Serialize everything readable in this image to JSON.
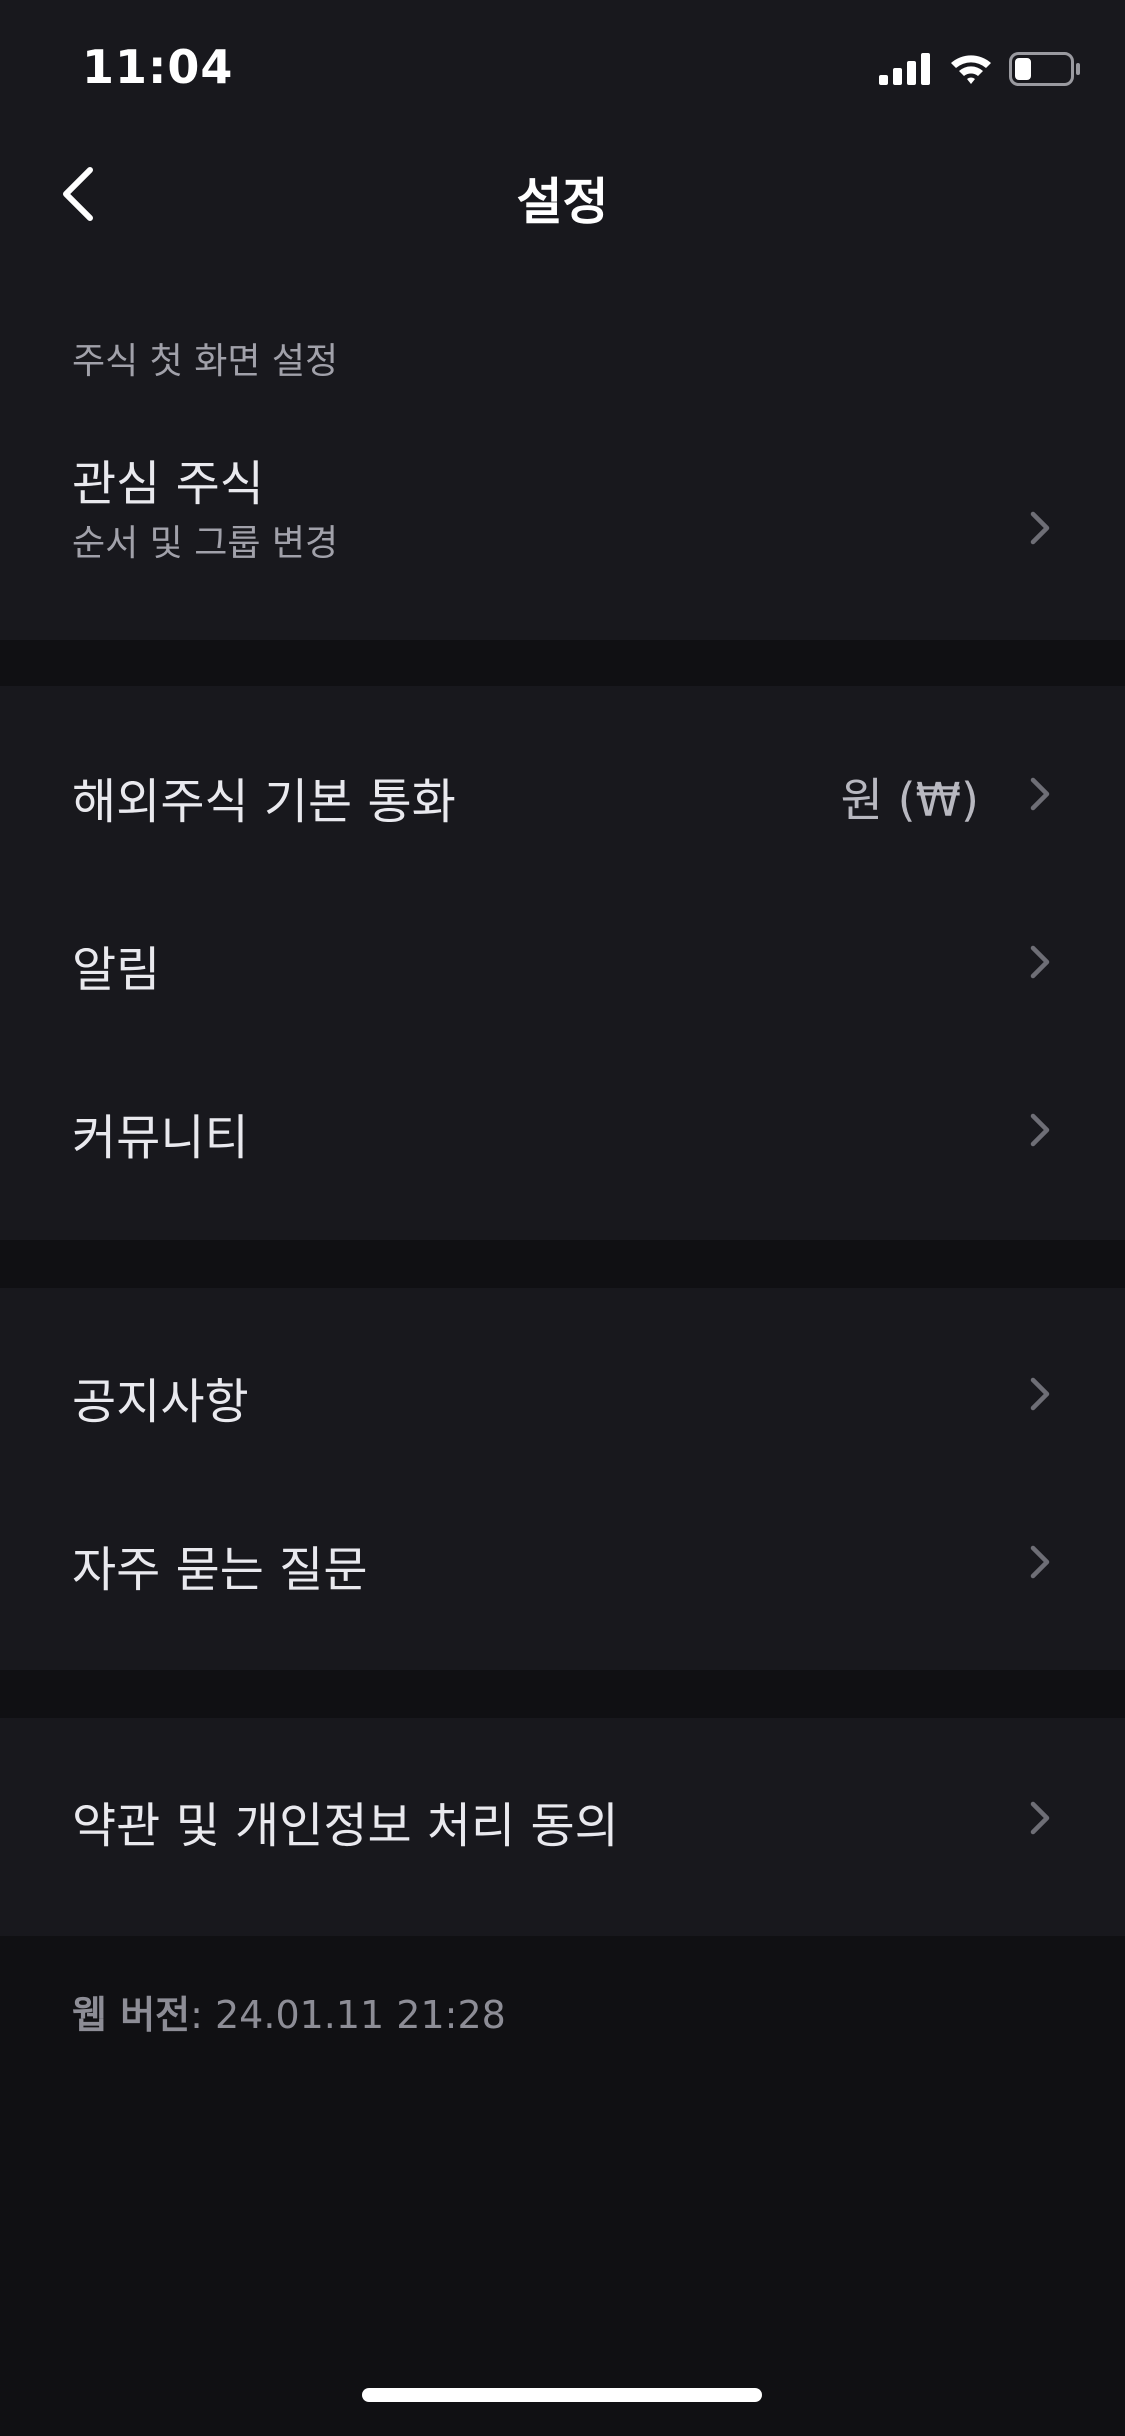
{
  "status_bar": {
    "time": "11:04",
    "signal_icon": "cellular-signal-icon",
    "wifi_icon": "wifi-icon",
    "battery_icon": "battery-icon",
    "battery_level": 0.3
  },
  "nav": {
    "back_icon": "chevron-left-icon",
    "title": "설정"
  },
  "sections": {
    "home_screen": {
      "caption": "주식 첫 화면 설정",
      "items": [
        {
          "label": "관심 주식",
          "sublabel": "순서 및 그룹 변경"
        }
      ]
    },
    "general": {
      "items": [
        {
          "label": "해외주식 기본 통화",
          "value": "원 (₩)"
        },
        {
          "label": "알림"
        },
        {
          "label": "커뮤니티"
        }
      ]
    },
    "support": {
      "items": [
        {
          "label": "공지사항"
        },
        {
          "label": "자주 묻는 질문"
        }
      ]
    },
    "legal": {
      "items": [
        {
          "label": "약관 및 개인정보 처리 동의"
        }
      ]
    }
  },
  "footer": {
    "version_key": "웹 버전",
    "version_value": ": 24.01.11 21:28"
  },
  "colors": {
    "background": "#101013",
    "surface": "#18181d",
    "text_primary": "#e9e9ee",
    "text_secondary": "#a1a1aa",
    "chevron": "#6e6e76"
  }
}
